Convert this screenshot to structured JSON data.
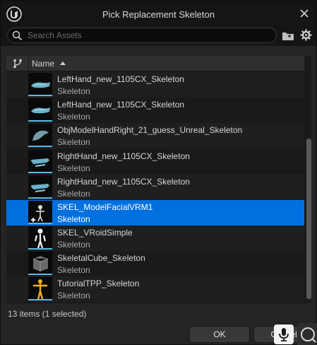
{
  "dialog": {
    "title": "Pick Replacement Skeleton",
    "close_icon": "close-icon"
  },
  "search": {
    "placeholder": "Search Assets",
    "value": ""
  },
  "list": {
    "header": {
      "type_icon": "asset-type-branch-icon",
      "name_label": "Name",
      "sort": "ascending"
    },
    "items": [
      {
        "name": "LeftHand_new_1105CX_Skeleton",
        "type": "Skeleton",
        "thumb": "hand-flat"
      },
      {
        "name": "LeftHand_new_1105CX_Skeleton",
        "type": "Skeleton",
        "thumb": "hand-flat"
      },
      {
        "name": "ObjModelHandRight_21_guess_Unreal_Skeleton",
        "type": "Skeleton",
        "thumb": "hand-curve"
      },
      {
        "name": "RightHand_new_1105CX_Skeleton",
        "type": "Skeleton",
        "thumb": "hand-right"
      },
      {
        "name": "RightHand_new_1105CX_Skeleton",
        "type": "Skeleton",
        "thumb": "hand-right"
      },
      {
        "name": "SKEL_ModelFacialVRM1",
        "type": "Skeleton",
        "thumb": "figure-small",
        "selected": true
      },
      {
        "name": "SKEL_VRoidSimple",
        "type": "Skeleton",
        "thumb": "figure-white"
      },
      {
        "name": "SkeletalCube_Skeleton",
        "type": "Skeleton",
        "thumb": "cube"
      },
      {
        "name": "TutorialTPP_Skeleton",
        "type": "Skeleton",
        "thumb": "figure-yellow"
      }
    ]
  },
  "status": "13 items (1 selected)",
  "buttons": {
    "ok": "OK",
    "cancel": "Cancel"
  },
  "colors": {
    "selection": "#0070e0",
    "thumb_underline": "#5db8e6"
  }
}
